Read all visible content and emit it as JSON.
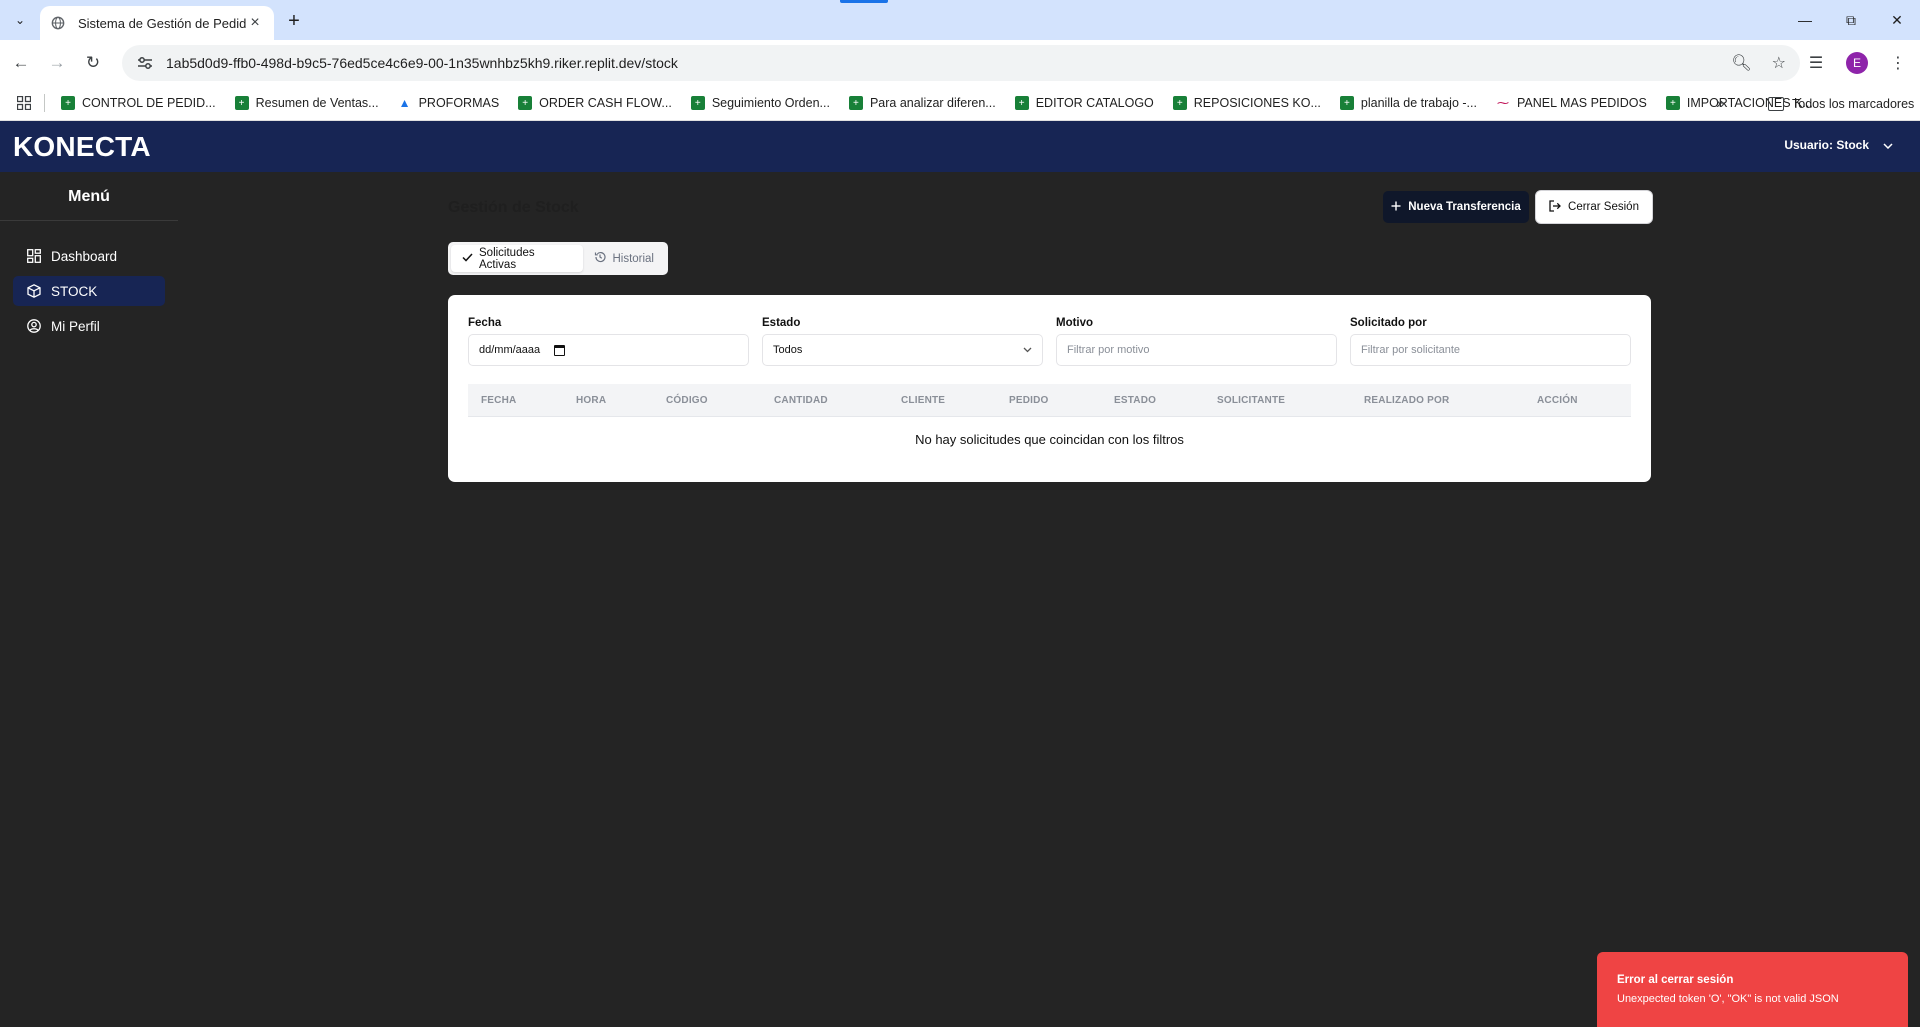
{
  "browser": {
    "tab_title": "Sistema de Gestión de Pedidos",
    "url": "1ab5d0d9-ffb0-498d-b9c5-76ed5ce4c6e9-00-1n35wnhbz5kh9.riker.replit.dev/stock",
    "profile_initial": "E",
    "bookmarks": [
      {
        "label": "CONTROL DE PEDID...",
        "icon": "sheets-icon"
      },
      {
        "label": "Resumen de Ventas...",
        "icon": "sheets-icon"
      },
      {
        "label": "PROFORMAS",
        "icon": "drive-icon"
      },
      {
        "label": "ORDER CASH FLOW...",
        "icon": "sheets-icon"
      },
      {
        "label": "Seguimiento Orden...",
        "icon": "sheets-icon"
      },
      {
        "label": "Para analizar diferen...",
        "icon": "sheets-icon"
      },
      {
        "label": "EDITOR CATALOGO",
        "icon": "sheets-icon"
      },
      {
        "label": "REPOSICIONES KO...",
        "icon": "sheets-icon"
      },
      {
        "label": "planilla de trabajo -...",
        "icon": "sheets-icon"
      },
      {
        "label": "PANEL MAS PEDIDOS",
        "icon": "panel-icon"
      },
      {
        "label": "IMPORTACIONES K...",
        "icon": "sheets-icon"
      }
    ],
    "all_bookmarks_label": "Todos los marcadores"
  },
  "header": {
    "brand": "KONECTA",
    "user_label": "Usuario: Stock"
  },
  "sidebar": {
    "title": "Menú",
    "items": [
      {
        "label": "Dashboard",
        "icon": "dashboard-icon",
        "active": false
      },
      {
        "label": "STOCK",
        "icon": "box-icon",
        "active": true
      },
      {
        "label": "Mi Perfil",
        "icon": "user-circle-icon",
        "active": false
      }
    ]
  },
  "main": {
    "title": "Gestión de Stock",
    "new_transfer_label": "Nueva Transferencia",
    "logout_label": "Cerrar Sesión",
    "tabs": [
      {
        "label": "Solicitudes Activas",
        "active": true
      },
      {
        "label": "Historial",
        "active": false
      }
    ],
    "filters": {
      "fecha": {
        "label": "Fecha",
        "value": "dd/mm/aaaa"
      },
      "estado": {
        "label": "Estado",
        "value": "Todos"
      },
      "motivo": {
        "label": "Motivo",
        "placeholder": "Filtrar por motivo"
      },
      "solicitado": {
        "label": "Solicitado por",
        "placeholder": "Filtrar por solicitante"
      }
    },
    "table": {
      "columns": [
        "FECHA",
        "HORA",
        "CÓDIGO",
        "CANTIDAD",
        "CLIENTE",
        "PEDIDO",
        "ESTADO",
        "SOLICITANTE",
        "REALIZADO POR",
        "ACCIÓN"
      ],
      "empty_message": "No hay solicitudes que coincidan con los filtros"
    }
  },
  "toast": {
    "title": "Error al cerrar sesión",
    "message": "Unexpected token 'O', \"OK\" is not valid JSON",
    "color": "#ef4444"
  },
  "colors": {
    "header_bg": "#172554",
    "page_bg": "#242424",
    "primary_button": "#0f172a"
  }
}
